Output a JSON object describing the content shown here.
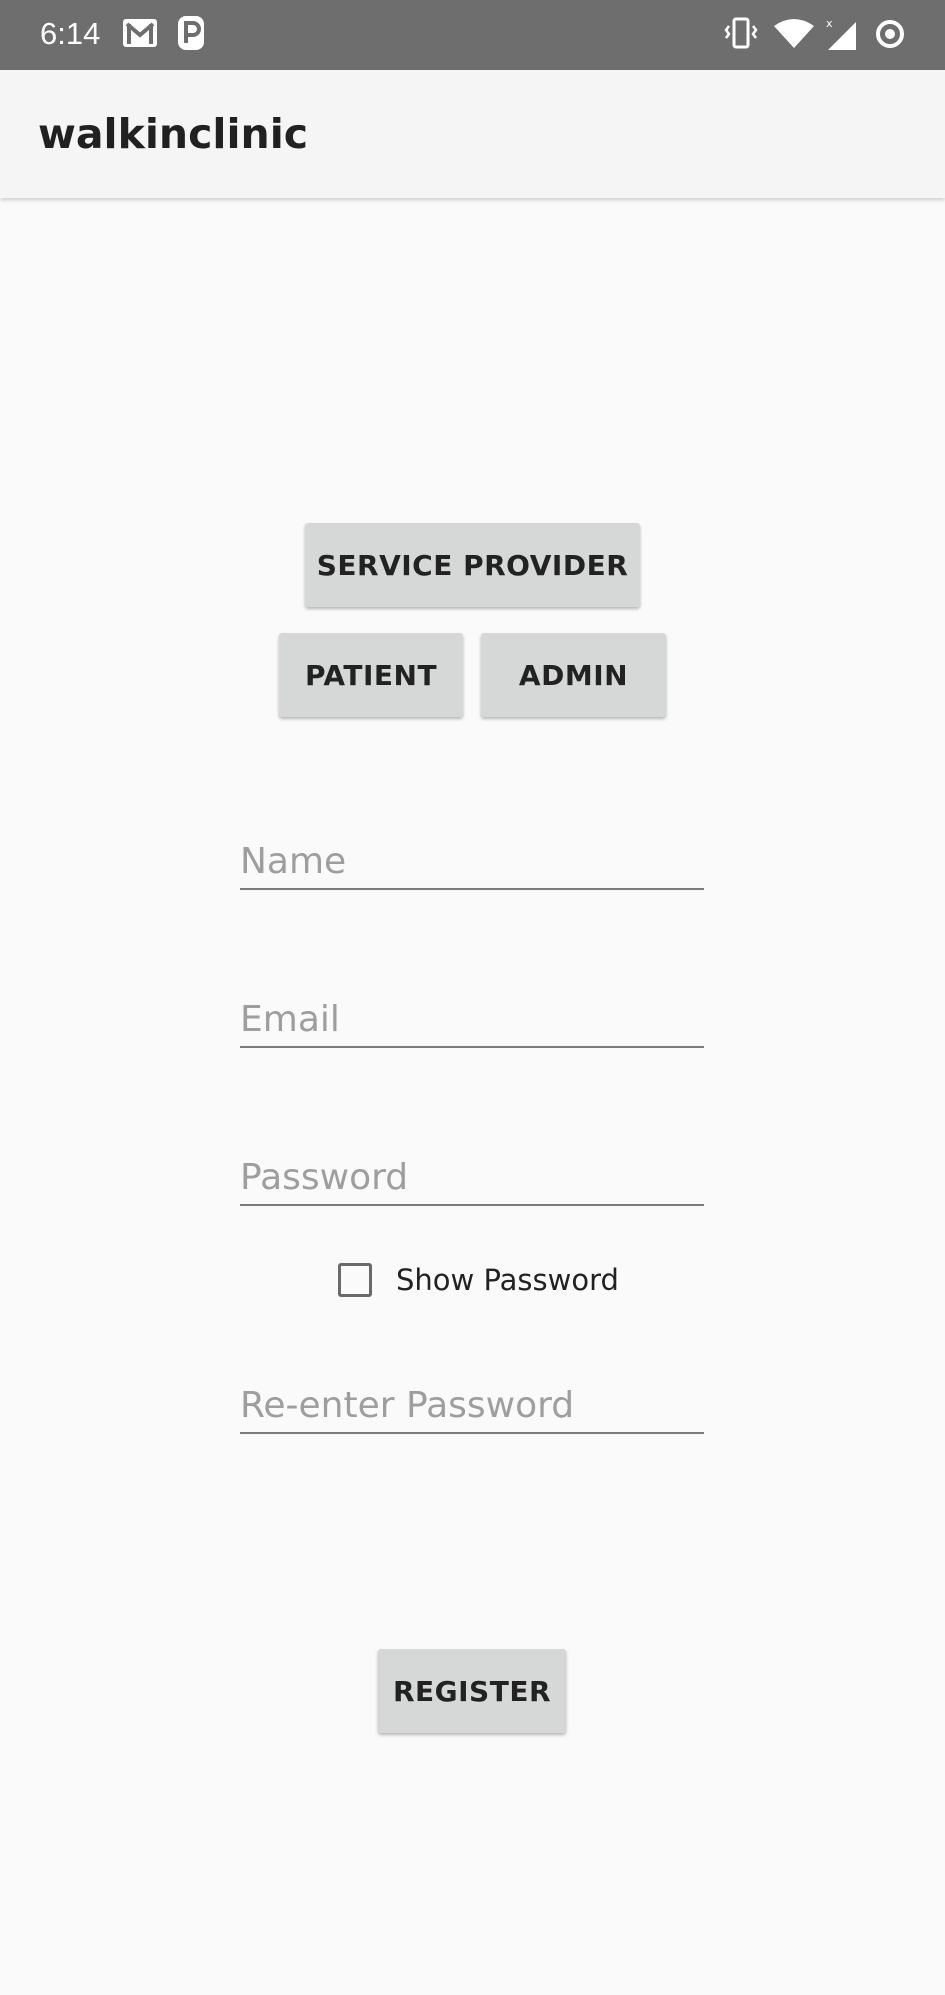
{
  "status_bar": {
    "time": "6:14",
    "icons": [
      "gmail-icon",
      "parking-icon",
      "vibrate-icon",
      "wifi-icon",
      "signal-icon",
      "sync-icon"
    ]
  },
  "app_bar": {
    "title": "walkinclinic"
  },
  "role_buttons": {
    "service_provider": "SERVICE PROVIDER",
    "patient": "PATIENT",
    "admin": "ADMIN"
  },
  "form": {
    "name_placeholder": "Name",
    "email_placeholder": "Email",
    "password_placeholder": "Password",
    "show_password_label": "Show Password",
    "show_password_checked": false,
    "reenter_password_placeholder": "Re-enter Password"
  },
  "register_button": "REGISTER",
  "colors": {
    "status_bar": "#6e6e6e",
    "app_bar": "#f5f5f5",
    "background": "#fafafa",
    "button": "#d6d7d7"
  }
}
